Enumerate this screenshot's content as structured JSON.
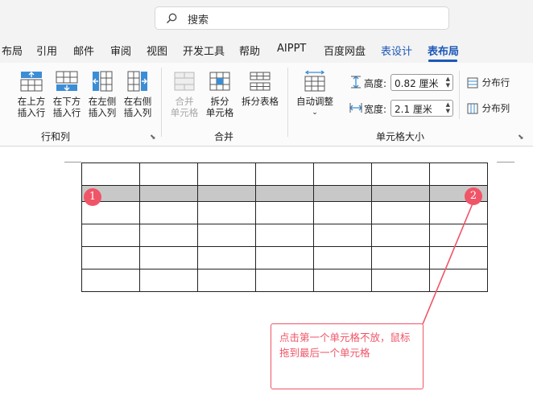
{
  "search": {
    "placeholder": "搜索"
  },
  "tabs": [
    {
      "label": "布局"
    },
    {
      "label": "引用"
    },
    {
      "label": "邮件"
    },
    {
      "label": "审阅"
    },
    {
      "label": "视图"
    },
    {
      "label": "开发工具"
    },
    {
      "label": "帮助"
    },
    {
      "label": "AIPPT"
    },
    {
      "label": "百度网盘"
    },
    {
      "label": "表设计"
    },
    {
      "label": "表布局"
    }
  ],
  "ribbon": {
    "rows_cols": {
      "label": "行和列",
      "insert_above": [
        "在上方",
        "插入行"
      ],
      "insert_below": [
        "在下方",
        "插入行"
      ],
      "insert_left": [
        "在左侧",
        "插入列"
      ],
      "insert_right": [
        "在右侧",
        "插入列"
      ]
    },
    "merge": {
      "label": "合并",
      "merge_cells": [
        "合并",
        "单元格"
      ],
      "split_cells": [
        "拆分",
        "单元格"
      ],
      "split_table": "拆分表格"
    },
    "cell_size": {
      "label": "单元格大小",
      "autofit": "自动调整",
      "height_label": "高度:",
      "height_value": "0.82 厘米",
      "width_label": "宽度:",
      "width_value": "2.1 厘米",
      "distribute_rows": "分布行",
      "distribute_cols": "分布列"
    }
  },
  "markers": {
    "start": "1",
    "end": "2"
  },
  "callout": {
    "text": "点击第一个单元格不放，鼠标拖到最后一个单元格"
  },
  "colors": {
    "accent": "#1d58b8",
    "annotation": "#f05567",
    "selection": "#c8c8c8"
  }
}
